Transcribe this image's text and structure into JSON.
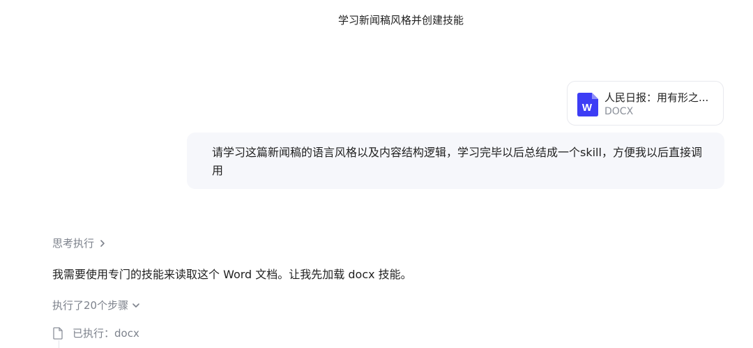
{
  "header": {
    "title": "学习新闻稿风格并创建技能"
  },
  "attachment": {
    "name": "人民日报：用有形之...",
    "type": "DOCX",
    "icon": "word-file-icon",
    "icon_letter": "W",
    "icon_color": "#3d3df5"
  },
  "user_message": {
    "text": "请学习这篇新闻稿的语言风格以及内容结构逻辑，学习完毕以后总结成一个skill，方便我以后直接调用"
  },
  "assistant": {
    "thinking_label": "思考执行",
    "reply": "我需要使用专门的技能来读取这个 Word 文档。让我先加载 docx 技能。",
    "steps_label": "执行了20个步骤",
    "step_items": [
      {
        "icon": "document-icon",
        "label": "已执行：docx"
      }
    ]
  },
  "colors": {
    "bubble_bg": "#f6f7fb",
    "muted_text": "#7d828c",
    "border": "#e8e9ee"
  }
}
